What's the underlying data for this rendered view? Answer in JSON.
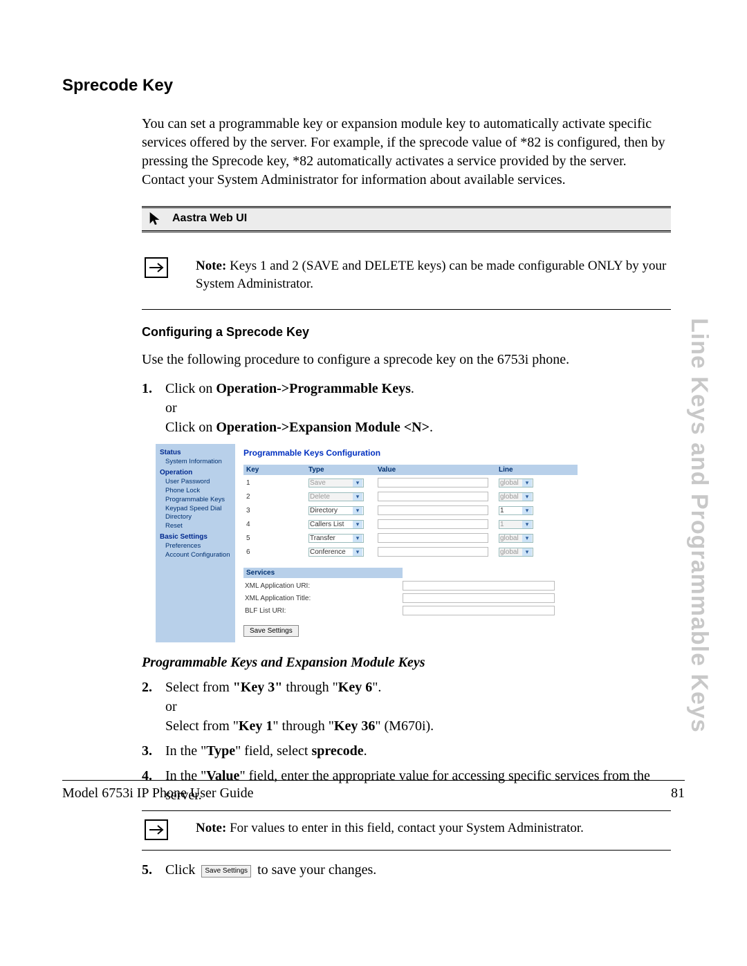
{
  "section_title": "Sprecode Key",
  "intro": "You can set a programmable key or expansion module key to automatically activate specific services offered by the server. For example, if the sprecode value of *82 is configured, then by pressing the Sprecode key, *82 automatically activates a service provided by the server. Contact your System Administrator for information about available services.",
  "webui_label": "Aastra Web UI",
  "note1_prefix": "Note: ",
  "note1_body": "Keys 1 and 2 (SAVE and DELETE keys) can be made configurable ONLY by your System Administrator.",
  "subhead": "Configuring a Sprecode Key",
  "proc_intro": "Use the following procedure to configure a sprecode key on the 6753i phone.",
  "step1": {
    "num": "1.",
    "a": "Click on ",
    "b": "Operation->Programmable Keys",
    "c": ".",
    "or": "or",
    "d": "Click on ",
    "e": "Operation->Expansion Module <N>",
    "f": "."
  },
  "italic_head": "Programmable Keys and Expansion Module Keys",
  "step2": {
    "num": "2.",
    "a": "Select from ",
    "b": "\"Key 3\"",
    "c": " through \"",
    "d": "Key 6",
    "e": "\".",
    "or": "or",
    "f": "Select from \"",
    "g": "Key 1",
    "h": "\" through \"",
    "i": "Key 36",
    "j": "\" (M670i)."
  },
  "step3": {
    "num": "3.",
    "a": "In the \"",
    "b": "Type",
    "c": "\" field, select ",
    "d": "sprecode",
    "e": "."
  },
  "step4": {
    "num": "4.",
    "a": "In the \"",
    "b": "Value",
    "c": "\" field, enter the appropriate value for accessing specific services from the server."
  },
  "note2_prefix": "Note: ",
  "note2_body": "For values to enter in this field, contact your System Administrator.",
  "step5": {
    "num": "5.",
    "a": "Click ",
    "btn": "Save Settings",
    "b": " to save your changes."
  },
  "side_tab": "Line Keys and Programmable Keys",
  "footer_left": "Model 6753i IP Phone User Guide",
  "footer_right": "81",
  "ui": {
    "title": "Programmable Keys Configuration",
    "sidebar": {
      "status": "Status",
      "sysinfo": "System Information",
      "operation": "Operation",
      "userpw": "User Password",
      "phonelock": "Phone Lock",
      "progkeys": "Programmable Keys",
      "ksd": "Keypad Speed Dial",
      "directory": "Directory",
      "reset": "Reset",
      "basic": "Basic Settings",
      "prefs": "Preferences",
      "acct": "Account Configuration"
    },
    "headers": {
      "key": "Key",
      "type": "Type",
      "value": "Value",
      "line": "Line"
    },
    "rows": [
      {
        "key": "1",
        "type": "Save",
        "type_disabled": true,
        "line": "global",
        "line_disabled": true
      },
      {
        "key": "2",
        "type": "Delete",
        "type_disabled": true,
        "line": "global",
        "line_disabled": true
      },
      {
        "key": "3",
        "type": "Directory",
        "type_disabled": false,
        "line": "1",
        "line_disabled": false
      },
      {
        "key": "4",
        "type": "Callers List",
        "type_disabled": false,
        "line": "1",
        "line_disabled": true
      },
      {
        "key": "5",
        "type": "Transfer",
        "type_disabled": false,
        "line": "global",
        "line_disabled": true
      },
      {
        "key": "6",
        "type": "Conference",
        "type_disabled": false,
        "line": "global",
        "line_disabled": true
      }
    ],
    "services": {
      "head": "Services",
      "xmluri": "XML Application URI:",
      "xmltitle": "XML Application Title:",
      "blf": "BLF List URI:"
    },
    "save": "Save Settings"
  }
}
